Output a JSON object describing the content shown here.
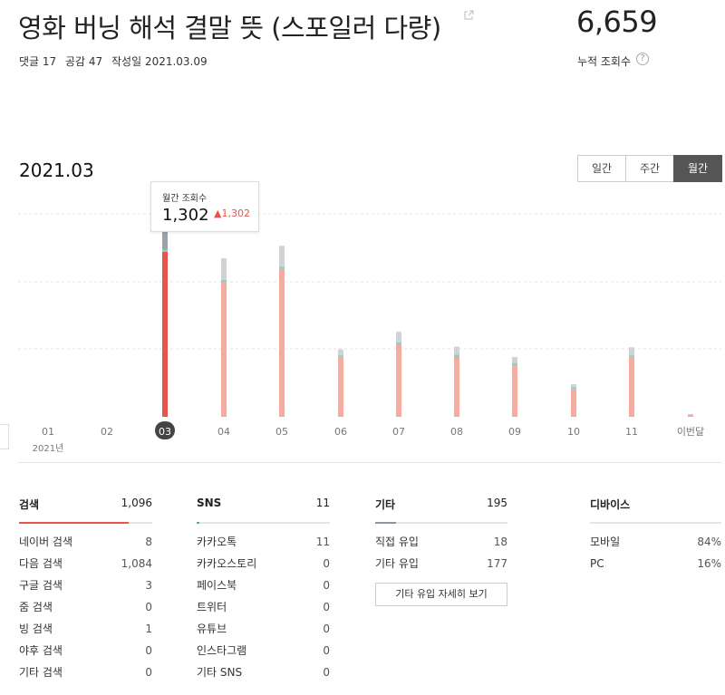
{
  "post": {
    "title": "영화 버닝 해석 결말 뜻 (스포일러 다량)",
    "comments": "댓글 17",
    "likes": "공감 47",
    "date": "작성일 2021.03.09"
  },
  "summary": {
    "total_views": "6,659",
    "total_label": "누적 조회수",
    "help": "?"
  },
  "period": {
    "label": "2021.03",
    "tabs": [
      {
        "label": "일간",
        "active": false
      },
      {
        "label": "주간",
        "active": false
      },
      {
        "label": "월간",
        "active": true
      }
    ]
  },
  "tooltip": {
    "label": "월간 조회수",
    "value": "1,302",
    "delta": "▲1,302"
  },
  "chart_data": {
    "type": "bar",
    "categories": [
      "01",
      "02",
      "03",
      "04",
      "05",
      "06",
      "07",
      "08",
      "09",
      "10",
      "11",
      "이번달"
    ],
    "year_label": "2021년",
    "selected_index": 2,
    "series": [
      {
        "values": [
          0,
          0,
          1302,
          1065,
          1168,
          470,
          571,
          475,
          410,
          220,
          470,
          20
        ]
      },
      {
        "values": [
          0,
          0,
          12,
          10,
          10,
          8,
          8,
          8,
          6,
          6,
          8,
          0
        ]
      },
      {
        "values": [
          0,
          0,
          217,
          170,
          166,
          47,
          85,
          64,
          47,
          23,
          64,
          0
        ]
      }
    ],
    "colors": {
      "main": "#f5aba0",
      "main_selected": "#e8544c",
      "teal": "#7fd3c8",
      "gray": "#d0d3d6",
      "gray_selected": "#9aa3ad"
    },
    "ylim": [
      0,
      1600
    ]
  },
  "stats": {
    "search": {
      "title": "검색",
      "total": "1,096",
      "color": "#e8544c",
      "ratio": 0.82,
      "rows": [
        {
          "label": "네이버 검색",
          "value": "8"
        },
        {
          "label": "다음 검색",
          "value": "1,084"
        },
        {
          "label": "구글 검색",
          "value": "3"
        },
        {
          "label": "줌 검색",
          "value": "0"
        },
        {
          "label": "빙 검색",
          "value": "1"
        },
        {
          "label": "야후 검색",
          "value": "0"
        },
        {
          "label": "기타 검색",
          "value": "0"
        }
      ]
    },
    "sns": {
      "title": "SNS",
      "total": "11",
      "color": "#2dba9c",
      "ratio": 0.02,
      "rows": [
        {
          "label": "카카오톡",
          "value": "11"
        },
        {
          "label": "카카오스토리",
          "value": "0"
        },
        {
          "label": "페이스북",
          "value": "0"
        },
        {
          "label": "트위터",
          "value": "0"
        },
        {
          "label": "유튜브",
          "value": "0"
        },
        {
          "label": "인스타그램",
          "value": "0"
        },
        {
          "label": "기타 SNS",
          "value": "0"
        }
      ]
    },
    "etc": {
      "title": "기타",
      "total": "195",
      "color": "#8c96a0",
      "ratio": 0.16,
      "rows": [
        {
          "label": "직접 유입",
          "value": "18"
        },
        {
          "label": "기타 유입",
          "value": "177"
        }
      ],
      "button": "기타 유입 자세히 보기"
    },
    "device": {
      "title": "디바이스",
      "rows": [
        {
          "label": "모바일",
          "value": "84%"
        },
        {
          "label": "PC",
          "value": "16%"
        }
      ]
    }
  }
}
